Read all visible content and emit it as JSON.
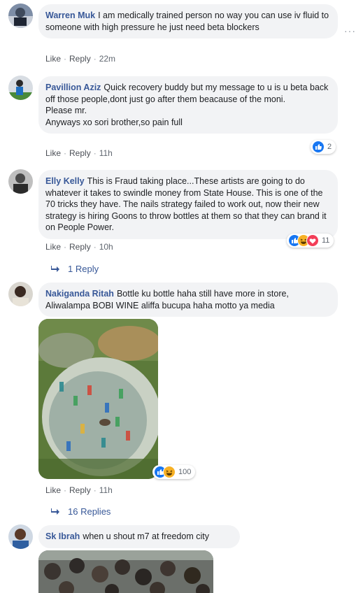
{
  "actions": {
    "like": "Like",
    "reply": "Reply"
  },
  "comments": [
    {
      "author": "Warren Muk",
      "text": "I am medically trained person no way you can use iv fluid to someone with high pressure he just need beta blockers",
      "time": "22m"
    },
    {
      "author": "Pavillion Aziz",
      "text": "Quick recovery buddy but my message to u is u beta back off those people,dont just go after them beacause of the moni.\nPlease mr.\nAnyways xo sori brother,so pain full",
      "time": "11h",
      "reactions": "2"
    },
    {
      "author": "Elly Kelly",
      "text": "This is Fraud taking place...These artists are going to do whatever it takes to swindle money from State House. This is one of the 70 tricks they have. The nails strategy failed to work out, now their new strategy is hiring Goons to throw bottles at them so that they can brand it on People Power.",
      "time": "10h",
      "reactions": "11",
      "replies": "1 Reply"
    },
    {
      "author": "Nakiganda Ritah",
      "text": "Bottle ku bottle haha still have more in store, Aliwalampa BOBI WINE aliffa bucupa haha motto ya media",
      "time": "11h",
      "reactions": "100",
      "replies": "16 Replies"
    },
    {
      "author": "Sk Ibrah",
      "text": "when u shout m7 at freedom city"
    }
  ],
  "more_icon": "more-options-icon",
  "colors": {
    "author": "#385898",
    "bubble": "#f2f3f5",
    "like": "#1877f2",
    "haha": "#f7b125",
    "love": "#f33e58"
  }
}
